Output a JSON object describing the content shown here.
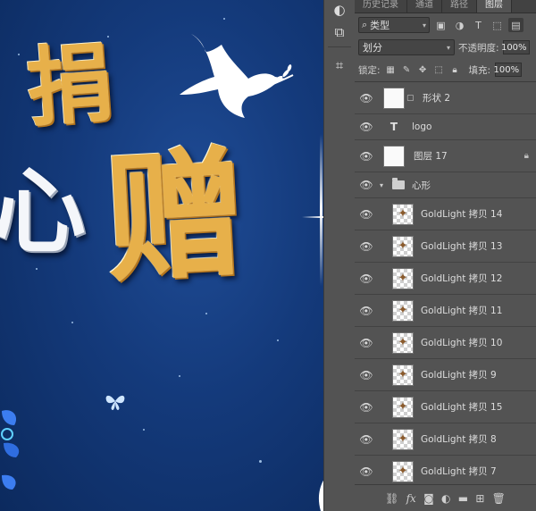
{
  "artwork": {
    "char_top": "捐",
    "char_left": "心",
    "char_big": "赠"
  },
  "tools": [
    {
      "icon": "quick-mask-icon",
      "glyph": "◐"
    },
    {
      "icon": "screen-mode-icon",
      "glyph": "⧉"
    },
    {
      "icon": "crop-icon",
      "glyph": "⌗"
    }
  ],
  "panel": {
    "tabs": [
      {
        "label": "历史记录",
        "active": false
      },
      {
        "label": "通道",
        "active": false
      },
      {
        "label": "路径",
        "active": false
      },
      {
        "label": "图层",
        "active": true
      }
    ],
    "filter": {
      "search_glyph": "⌕",
      "value": "类型"
    },
    "blend_mode": "划分",
    "opacity_label": "不透明度:",
    "opacity_value": "100%",
    "lock_label": "锁定:",
    "fill_label": "填充:",
    "fill_value": "100%",
    "layers": [
      {
        "name": "形状 2",
        "kind": "shape",
        "visible": true
      },
      {
        "name": "logo",
        "kind": "text",
        "visible": true
      },
      {
        "name": "图层 17",
        "kind": "raster-locked",
        "visible": true
      },
      {
        "name": "心形",
        "kind": "group",
        "visible": true
      },
      {
        "name": "GoldLight 拷贝 14",
        "kind": "child",
        "visible": true
      },
      {
        "name": "GoldLight 拷贝 13",
        "kind": "child",
        "visible": true
      },
      {
        "name": "GoldLight 拷贝 12",
        "kind": "child",
        "visible": true
      },
      {
        "name": "GoldLight 拷贝 11",
        "kind": "child",
        "visible": true
      },
      {
        "name": "GoldLight 拷贝 10",
        "kind": "child",
        "visible": true
      },
      {
        "name": "GoldLight 拷贝 9",
        "kind": "child",
        "visible": true
      },
      {
        "name": "GoldLight 拷贝 15",
        "kind": "child",
        "visible": true
      },
      {
        "name": "GoldLight 拷贝 8",
        "kind": "child",
        "visible": true
      },
      {
        "name": "GoldLight 拷贝 7",
        "kind": "child",
        "visible": true
      }
    ],
    "bottom_icons": [
      "link-icon",
      "fx-icon",
      "mask-icon",
      "adjustment-icon",
      "folder-icon",
      "new-layer-icon",
      "trash-icon"
    ]
  },
  "colors": {
    "canvas_bg": "#143a7b",
    "gold": "#e7b04a",
    "panel_bg": "#535353"
  }
}
